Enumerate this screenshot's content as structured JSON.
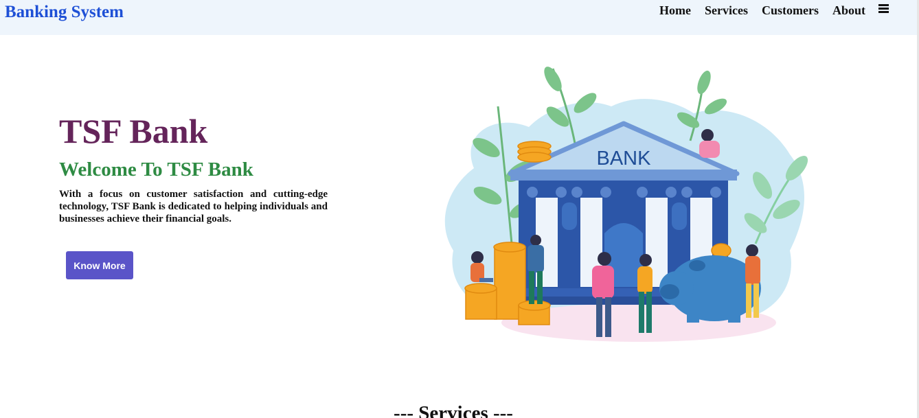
{
  "navbar": {
    "brand": "Banking System",
    "links": [
      {
        "label": "Home"
      },
      {
        "label": "Services"
      },
      {
        "label": "Customers"
      },
      {
        "label": "About"
      }
    ],
    "menu_icon": "hamburger-menu-icon"
  },
  "hero": {
    "title": "TSF Bank",
    "subtitle": "Welcome To TSF Bank",
    "description": "With a focus on customer satisfaction and cutting-edge technology, TSF Bank is dedicated to helping individuals and businesses achieve their financial goals.",
    "button_label": "Know More",
    "illustration_sign": "BANK"
  },
  "services": {
    "heading": "--- Services ---"
  },
  "colors": {
    "brand": "#1e50d6",
    "title": "#64245a",
    "subtitle": "#2e8b43",
    "button": "#5a54c8",
    "navbar_bg": "#eef5fc"
  }
}
